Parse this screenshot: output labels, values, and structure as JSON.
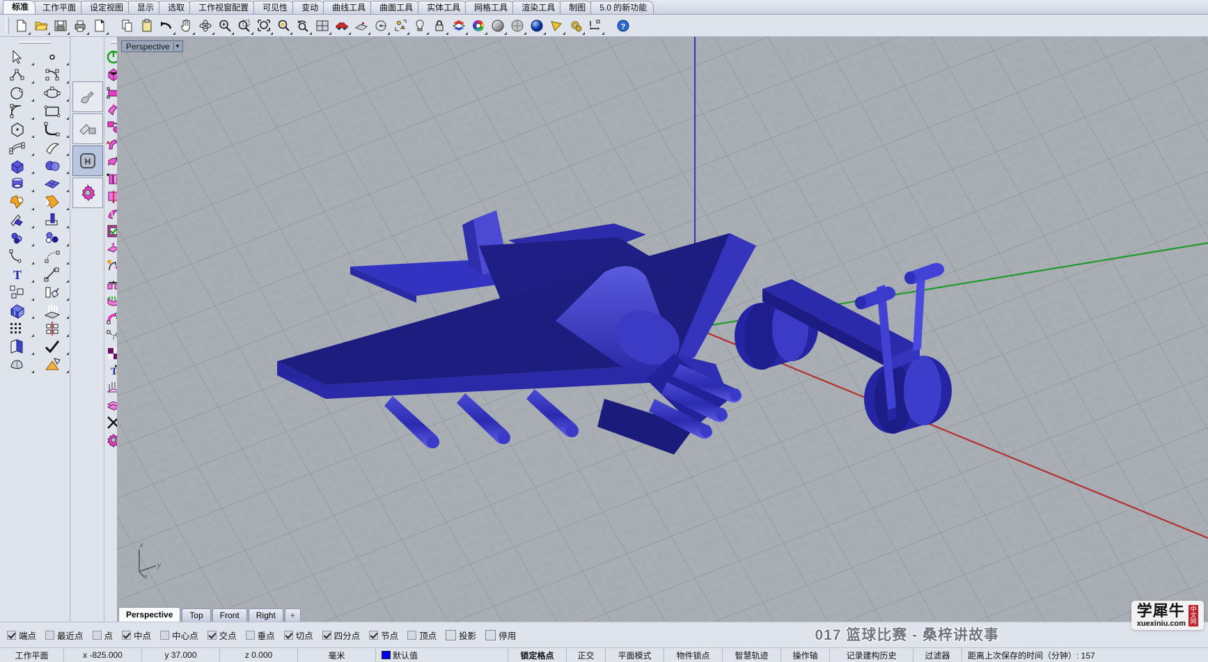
{
  "app": {
    "title": "Rhinoceros",
    "accent": "#2020c8",
    "viewport_bg": "#a9aeb4"
  },
  "menubar": {
    "tabs": [
      {
        "label": "标准",
        "active": true
      },
      {
        "label": "工作平面",
        "active": false
      },
      {
        "label": "设定视图",
        "active": false
      },
      {
        "label": "显示",
        "active": false
      },
      {
        "label": "选取",
        "active": false
      },
      {
        "label": "工作视窗配置",
        "active": false
      },
      {
        "label": "可见性",
        "active": false
      },
      {
        "label": "变动",
        "active": false
      },
      {
        "label": "曲线工具",
        "active": false
      },
      {
        "label": "曲面工具",
        "active": false
      },
      {
        "label": "实体工具",
        "active": false
      },
      {
        "label": "网格工具",
        "active": false
      },
      {
        "label": "渲染工具",
        "active": false
      },
      {
        "label": "制图",
        "active": false
      },
      {
        "label": "5.0 的新功能",
        "active": false
      }
    ]
  },
  "toolbar": {
    "buttons": [
      {
        "name": "new-file-icon",
        "tip": "新建"
      },
      {
        "name": "open-file-icon",
        "tip": "开启"
      },
      {
        "name": "save-file-icon",
        "tip": "储存"
      },
      {
        "name": "print-icon",
        "tip": "打印"
      },
      {
        "name": "cut-icon",
        "tip": "剪下"
      },
      {
        "name": "copy-icon",
        "tip": "复制"
      },
      {
        "name": "paste-icon",
        "tip": "贴上"
      },
      {
        "name": "undo-icon",
        "tip": "复原"
      },
      {
        "name": "pan-icon",
        "tip": "平移"
      },
      {
        "name": "rotate-view-icon",
        "tip": "旋转视图"
      },
      {
        "name": "zoom-in-icon",
        "tip": "放大"
      },
      {
        "name": "zoom-window-icon",
        "tip": "框选缩放"
      },
      {
        "name": "zoom-extents-icon",
        "tip": "缩放至全部"
      },
      {
        "name": "zoom-selected-icon",
        "tip": "缩放至选取物件"
      },
      {
        "name": "zoom-previous-icon",
        "tip": "上一个视图"
      },
      {
        "name": "four-viewport-icon",
        "tip": "四个工作视窗"
      },
      {
        "name": "car-render-icon",
        "tip": "渲染"
      },
      {
        "name": "cplane-icon",
        "tip": "工作平面"
      },
      {
        "name": "named-view-icon",
        "tip": "命名视图"
      },
      {
        "name": "named-cplane-icon",
        "tip": "命名工作平面"
      },
      {
        "name": "light-icon",
        "tip": "灯光"
      },
      {
        "name": "lock-icon",
        "tip": "锁定"
      },
      {
        "name": "layer-icon",
        "tip": "图层"
      },
      {
        "name": "color-wheel-icon",
        "tip": "颜色"
      },
      {
        "name": "shaded-sphere-icon",
        "tip": "着色模式"
      },
      {
        "name": "ghosted-sphere-icon",
        "tip": "半透明模式"
      },
      {
        "name": "rendered-sphere-icon",
        "tip": "渲染模式"
      },
      {
        "name": "flat-shade-icon",
        "tip": "平坦着色"
      },
      {
        "name": "options-gear-icon",
        "tip": "选项"
      },
      {
        "name": "dimension-icon",
        "tip": "标注"
      },
      {
        "name": "help-icon",
        "tip": "说明"
      }
    ]
  },
  "sidebar": {
    "items": [
      {
        "name": "select-arrow-icon"
      },
      {
        "name": "point-icon"
      },
      {
        "name": "polyline-icon"
      },
      {
        "name": "control-point-curve-icon"
      },
      {
        "name": "circle-icon"
      },
      {
        "name": "ellipse-icon"
      },
      {
        "name": "arc-icon"
      },
      {
        "name": "rectangle-icon"
      },
      {
        "name": "polygon-icon"
      },
      {
        "name": "fillet-curve-icon"
      },
      {
        "name": "surface-from-points-icon"
      },
      {
        "name": "loft-surface-icon"
      },
      {
        "name": "box-icon"
      },
      {
        "name": "sphere-boolean-icon"
      },
      {
        "name": "cylinder-icon"
      },
      {
        "name": "surface-grid-icon"
      },
      {
        "name": "boolean-union-icon"
      },
      {
        "name": "boolean-difference-icon"
      },
      {
        "name": "trim-icon"
      },
      {
        "name": "split-icon"
      },
      {
        "name": "boolean-sphere-icon"
      },
      {
        "name": "boolean-two-icon"
      },
      {
        "name": "blend-curve-icon"
      },
      {
        "name": "arc-blend-icon"
      },
      {
        "name": "text-icon"
      },
      {
        "name": "leader-icon"
      },
      {
        "name": "array-icon"
      },
      {
        "name": "scale-icon"
      },
      {
        "name": "extrude-icon"
      },
      {
        "name": "extrude-up-icon"
      },
      {
        "name": "grid-array-icon"
      },
      {
        "name": "mirror-icon"
      },
      {
        "name": "unroll-icon"
      },
      {
        "name": "check-icon"
      },
      {
        "name": "mesh-icon"
      },
      {
        "name": "render-mesh-icon"
      }
    ]
  },
  "tool_panel": {
    "items": [
      {
        "name": "pick-tool-icon"
      },
      {
        "name": "place-object-icon"
      },
      {
        "name": "hide-tool-icon",
        "label": "H"
      },
      {
        "name": "gear-magenta-icon"
      }
    ]
  },
  "sidebar_magenta": {
    "items": [
      {
        "name": "power-toggle-icon"
      },
      {
        "name": "extract-surface-icon"
      },
      {
        "name": "cube-magenta-icon"
      },
      {
        "name": "twist-icon"
      },
      {
        "name": "edit-points-icon"
      },
      {
        "name": "cage-edit-icon"
      },
      {
        "name": "flow-icon"
      },
      {
        "name": "flow-along-surface-icon"
      },
      {
        "name": "rotate3d-icon"
      },
      {
        "name": "shear-icon"
      },
      {
        "name": "bend-icon"
      },
      {
        "name": "taper-icon"
      },
      {
        "name": "smash-icon"
      },
      {
        "name": "unroll-surface-icon"
      },
      {
        "name": "add-knot-icon"
      },
      {
        "name": "insert-knot-icon"
      },
      {
        "name": "split-surface-icon"
      },
      {
        "name": "cage-box-icon"
      },
      {
        "name": "sweep1-icon"
      },
      {
        "name": "sweep2-icon"
      },
      {
        "name": "surface-checker-icon"
      },
      {
        "name": "surface-grid-pink-icon"
      },
      {
        "name": "offset-surface-icon"
      },
      {
        "name": "control-points-on-icon"
      },
      {
        "name": "match-surface-icon"
      },
      {
        "name": "match-curve-icon"
      },
      {
        "name": "symmetry-icon"
      },
      {
        "name": "soft-edit-icon"
      },
      {
        "name": "drape-icon"
      },
      {
        "name": "point-cloud-icon"
      },
      {
        "name": "blend-surface-icon"
      },
      {
        "name": "patch-icon"
      },
      {
        "name": "converge-icon"
      },
      {
        "name": "curvature-icon"
      },
      {
        "name": "texture-map-icon"
      },
      {
        "name": "uv-editor-icon"
      },
      {
        "name": "text-object-icon"
      },
      {
        "name": "mesh-polygon-icon"
      },
      {
        "name": "loft-pink-icon"
      },
      {
        "name": "fin-icon"
      },
      {
        "name": "surface-array-icon"
      },
      {
        "name": "surface-tile-icon"
      },
      {
        "name": "converge-lines-icon"
      },
      {
        "name": "fill-hole-icon"
      },
      {
        "name": "gear-settings-icon"
      }
    ]
  },
  "viewport": {
    "label": "Perspective",
    "dropdown_glyph": "▾",
    "tabs": [
      {
        "label": "Perspective",
        "active": true
      },
      {
        "label": "Top",
        "active": false
      },
      {
        "label": "Front",
        "active": false
      },
      {
        "label": "Right",
        "active": false
      },
      {
        "label": "+",
        "active": false
      }
    ],
    "axis_labels": {
      "x": "x",
      "y": "y",
      "z": "z"
    },
    "axis_colors": {
      "x": "#c02020",
      "y": "#00a000",
      "z": "#2020c8"
    },
    "objects": [
      {
        "name": "airplane-model",
        "color": "#2323b4"
      },
      {
        "name": "bicycle-model",
        "color": "#2323b4"
      }
    ]
  },
  "osnap": {
    "items": [
      {
        "label": "端点",
        "checked": true
      },
      {
        "label": "最近点",
        "checked": false
      },
      {
        "label": "点",
        "checked": false
      },
      {
        "label": "中点",
        "checked": true
      },
      {
        "label": "中心点",
        "checked": false
      },
      {
        "label": "交点",
        "checked": true
      },
      {
        "label": "垂点",
        "checked": false
      },
      {
        "label": "切点",
        "checked": true
      },
      {
        "label": "四分点",
        "checked": true
      },
      {
        "label": "节点",
        "checked": true
      },
      {
        "label": "顶点",
        "checked": false
      },
      {
        "label": "投影",
        "checked": false,
        "big": true
      },
      {
        "label": "停用",
        "checked": false,
        "big": true
      }
    ]
  },
  "status": {
    "cplane_label": "工作平面",
    "x": "x  -825.000",
    "y": "y  37.000",
    "z": "z  0.000",
    "units": "毫米",
    "layer": "默认值",
    "layer_color": "#0000ee",
    "toggles": [
      {
        "label": "锁定格点",
        "bold": true
      },
      {
        "label": "正交",
        "bold": false
      },
      {
        "label": "平面模式",
        "bold": false
      },
      {
        "label": "物件锁点",
        "bold": false
      },
      {
        "label": "智慧轨迹",
        "bold": false
      },
      {
        "label": "操作轴",
        "bold": false
      },
      {
        "label": "记录建构历史",
        "bold": false
      },
      {
        "label": "过滤器",
        "bold": false
      }
    ],
    "autosave": "距离上次保存的时间（分钟）: 157"
  },
  "watermark": {
    "text": "017 篮球比赛 - 桑梓讲故事",
    "logo_cn": "学犀牛",
    "logo_url": "xuexiniu.com",
    "logo_badge": "中文网"
  }
}
